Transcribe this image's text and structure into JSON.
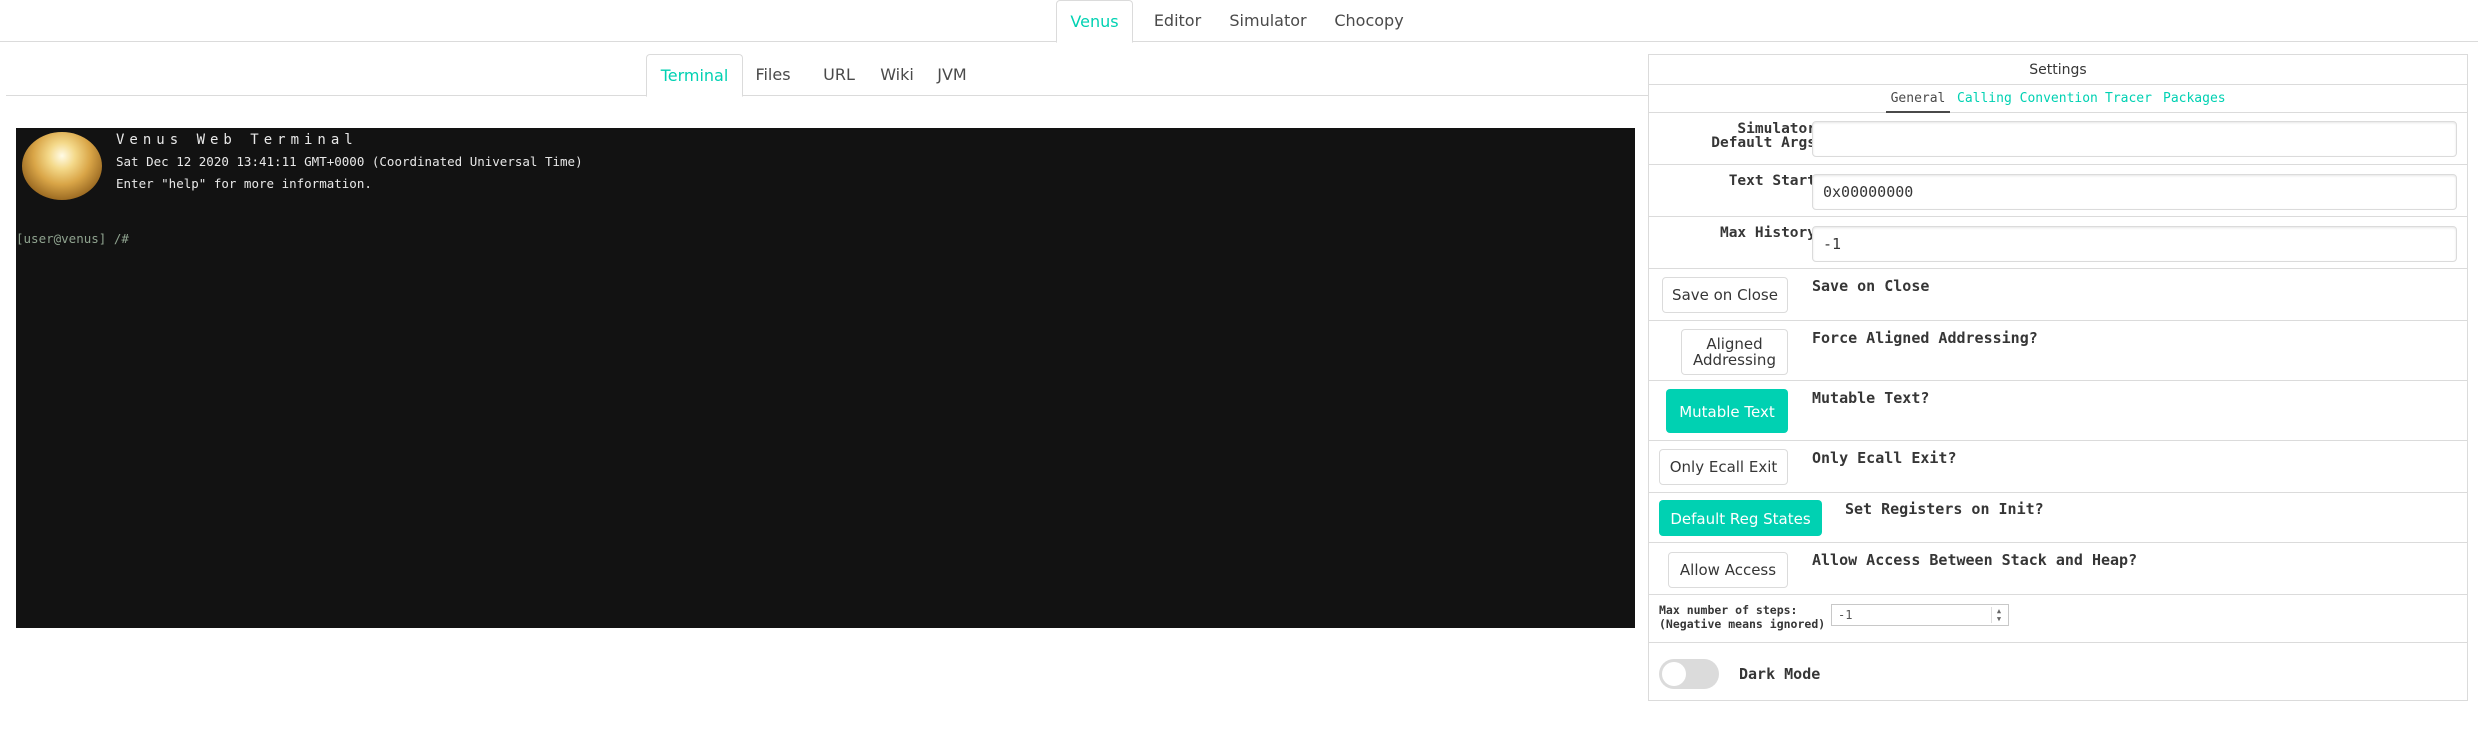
{
  "top_tabs": [
    "Venus",
    "Editor",
    "Simulator",
    "Chocopy"
  ],
  "sub_tabs": [
    "Terminal",
    "Files",
    "URL",
    "Wiki",
    "JVM"
  ],
  "terminal": {
    "title": "Venus Web Terminal",
    "lines": [
      "Sat Dec 12 2020 13:41:11 GMT+0000 (Coordinated Universal Time)",
      "Enter \"help\" for more information."
    ],
    "prompt": "[user@venus] /#"
  },
  "settings": {
    "title": "Settings",
    "tabs": [
      "General",
      "Calling Convention",
      "Tracer",
      "Packages"
    ],
    "simulator_args_label": "Simulator Default Args",
    "simulator_args_value": "",
    "text_start_label": "Text Start",
    "text_start_value": "0x00000000",
    "max_history_label": "Max History",
    "max_history_value": "-1",
    "toggles": [
      {
        "button": "Save on Close",
        "description": "Save on Close",
        "active": false
      },
      {
        "button": "Aligned Addressing",
        "description": "Force Aligned Addressing?",
        "active": false
      },
      {
        "button": "Mutable Text",
        "description": "Mutable Text?",
        "active": true
      },
      {
        "button": "Only Ecall Exit",
        "description": "Only Ecall Exit?",
        "active": false
      },
      {
        "button": "Default Reg States",
        "description": "Set Registers on Init?",
        "active": true
      },
      {
        "button": "Allow Access",
        "description": "Allow Access Between Stack and Heap?",
        "active": false
      }
    ],
    "max_steps_label_1": "Max number of steps:",
    "max_steps_label_2": "(Negative means ignored)",
    "max_steps_value": "-1",
    "dark_mode_label": "Dark Mode",
    "dark_mode_on": false
  },
  "colors": {
    "accent": "#00d1b2",
    "terminal_bg": "#121212"
  }
}
